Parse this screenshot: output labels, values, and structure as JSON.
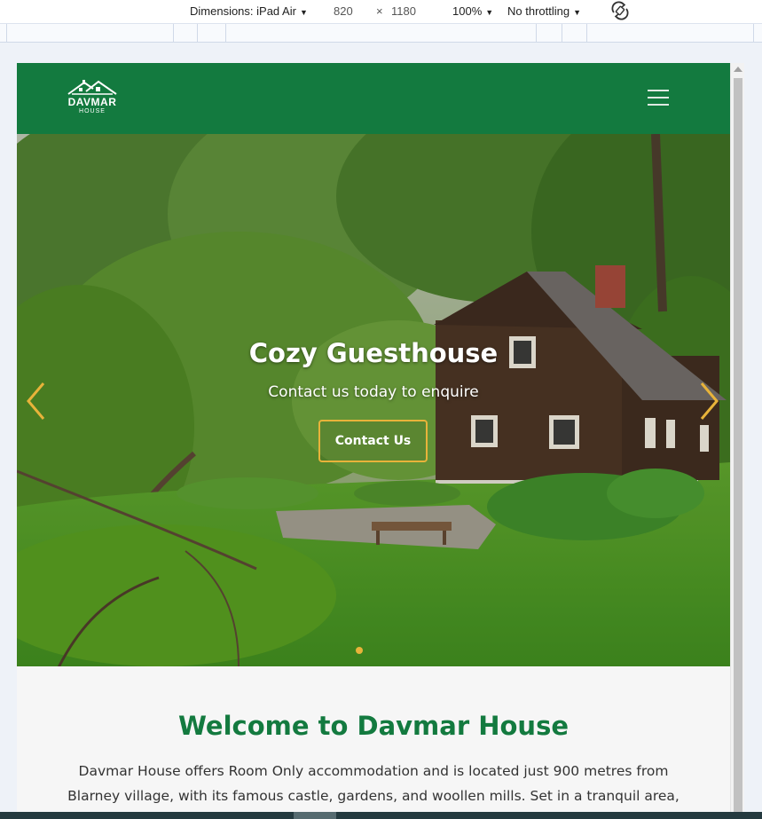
{
  "devtools": {
    "device_label": "Dimensions: iPad Air",
    "width_value": "820",
    "times": "×",
    "height_value": "1180",
    "zoom_label": "100%",
    "throttling_label": "No throttling",
    "dropdown_glyph": "▼"
  },
  "site": {
    "logo": {
      "name": "DAVMAR",
      "sub": "HOUSE"
    },
    "hero": {
      "title": "Cozy Guesthouse",
      "subtitle": "Contact us today to enquire",
      "button_label": "Contact Us",
      "slide_count": 1,
      "active_slide": 1
    },
    "welcome": {
      "title": "Welcome to Davmar House",
      "text": "Davmar House offers Room Only accommodation and is located just 900 metres from Blarney village, with its famous castle, gardens, and woollen mills. Set in a tranquil area, it"
    }
  },
  "colors": {
    "brand_green": "#137a3f",
    "accent_gold": "#e8b33a",
    "welcome_title": "#137a3f"
  },
  "icons": {
    "menu": "hamburger-icon",
    "prev": "chevron-left-icon",
    "next": "chevron-right-icon",
    "rotate": "rotate-icon",
    "logo": "house-roof-icon"
  }
}
